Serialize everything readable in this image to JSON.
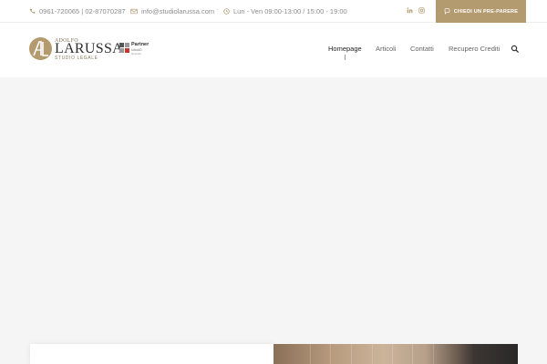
{
  "topbar": {
    "phone": "0961-720065 | 02-87070287",
    "email": "info@studiolarussa.com",
    "hours": "Lun - Ven 09:00-13:00 / 15:00 - 19:00",
    "separator": "-",
    "social": [
      "linkedin-icon",
      "instagram-icon"
    ],
    "cta_label": "CHIEDI UN PRE-PARERE"
  },
  "logo": {
    "small": "ADOLFO",
    "big": "LARUSSA",
    "sub": "STUDIO LEGALE",
    "partner_title": "Partner",
    "partner_sub": "tuttoAD",
    "partner_sub2": "Network"
  },
  "nav": {
    "items": [
      "Homepage",
      "Articoli",
      "Contatti",
      "Recupero Crediti"
    ],
    "active": "Homepage"
  },
  "colors": {
    "accent": "#b39a6f",
    "hero_bg": "#f5f5f5",
    "text": "#666666"
  }
}
